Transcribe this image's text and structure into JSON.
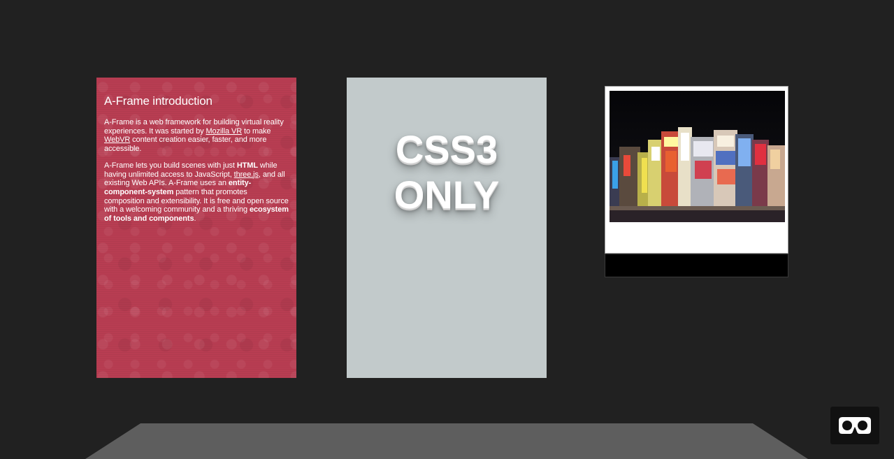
{
  "scene": {
    "background_color": "#212121",
    "floor_color": "#5e5e5e"
  },
  "intro_panel": {
    "title": "A-Frame introduction",
    "p1": {
      "t1": "A-Frame is a web framework for building virtual reality experiences. It was started by ",
      "link1": "Mozilla VR",
      "t2": " to make ",
      "link2": "WebVR",
      "t3": " content creation easier, faster, and more accessible."
    },
    "p2": {
      "t1": "A-Frame lets you build scenes with just ",
      "b1": "HTML",
      "t2": " while having unlimited access to JavaScript, ",
      "link1": "three.js",
      "t3": ", and all existing Web APIs. A-Frame uses an ",
      "b2": "entity-component-system",
      "t4": " pattern that promotes composition and extensibility. It is free and open source with a welcoming community and a thriving ",
      "b3": "ecosystem of tools and components",
      "t5": "."
    },
    "background_color": "#b83d52"
  },
  "css_panel": {
    "line1": "CSS3",
    "line2": "ONLY",
    "background_color": "#c2cacb"
  },
  "photo_panel": {
    "icon": "city-night-photo"
  },
  "vr_button": {
    "icon": "vr-goggles-icon"
  }
}
